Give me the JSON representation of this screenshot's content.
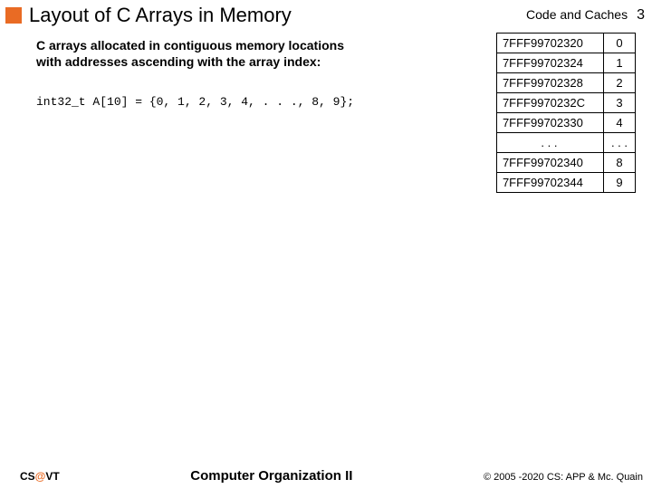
{
  "header": {
    "title": "Layout of C Arrays in Memory",
    "topic": "Code and Caches",
    "page": "3"
  },
  "lead": "C arrays allocated in contiguous memory locations with addresses ascending with the array index:",
  "code_line": "int32_t A[10] = {0, 1, 2, 3, 4, . . ., 8, 9};",
  "mem_rows": [
    {
      "addr": "7FFF99702320",
      "val": "0"
    },
    {
      "addr": "7FFF99702324",
      "val": "1"
    },
    {
      "addr": "7FFF99702328",
      "val": "2"
    },
    {
      "addr": "7FFF9970232C",
      "val": "3"
    },
    {
      "addr": "7FFF99702330",
      "val": "4"
    },
    {
      "addr": ". . .",
      "val": ". . ."
    },
    {
      "addr": "7FFF99702340",
      "val": "8"
    },
    {
      "addr": "7FFF99702344",
      "val": "9"
    }
  ],
  "footer": {
    "org_pre": "CS",
    "org_at": "@",
    "org_post": "VT",
    "center": "Computer Organization II",
    "right": "© 2005 -2020 CS: APP & Mc. Quain"
  }
}
